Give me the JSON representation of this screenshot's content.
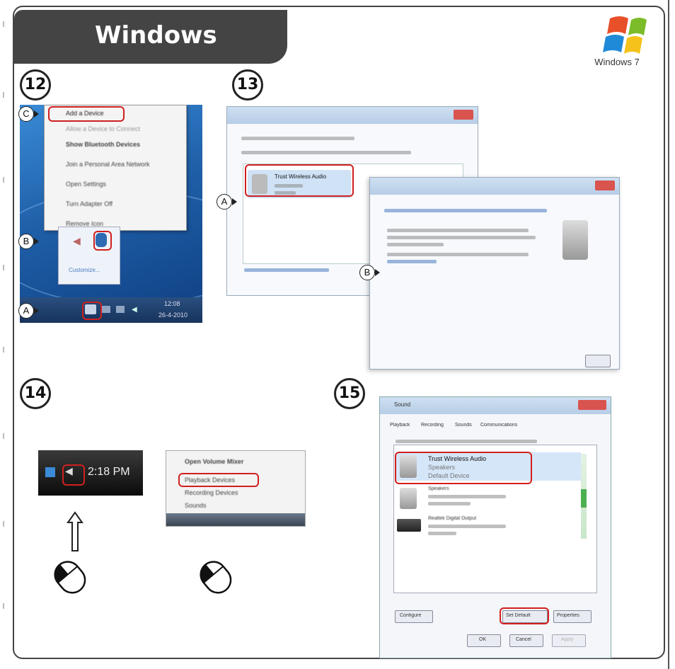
{
  "header": {
    "title": "Windows"
  },
  "logo": {
    "label": "Windows 7",
    "icon": "windows-flag-icon"
  },
  "steps": {
    "s12": "12",
    "s13": "13",
    "s14": "14",
    "s15": "15"
  },
  "callouts": {
    "a": "A",
    "b": "B",
    "c": "C"
  },
  "step12": {
    "menu": [
      "Add a Device",
      "Allow a Device to Connect",
      "Show Bluetooth Devices",
      "Join a Personal Area Network",
      "Open Settings",
      "Turn Adapter Off",
      "Remove Icon"
    ],
    "customize": "Customize...",
    "clock_time": "12:08",
    "clock_date": "26-4-2010"
  },
  "step13": {
    "device_name": "Trust Wireless Audio"
  },
  "step14": {
    "clock": "2:18 PM",
    "menu": [
      "Open Volume Mixer",
      "Playback Devices",
      "Recording Devices",
      "Sounds"
    ]
  },
  "step15": {
    "window_title": "Sound",
    "tabs": [
      "Playback",
      "Recording",
      "Sounds",
      "Communications"
    ],
    "device": {
      "name": "Trust Wireless Audio",
      "type": "Speakers",
      "status": "Default Device"
    },
    "devices_other": [
      "Speakers",
      "Realtek Digital Output"
    ],
    "buttons": {
      "configure": "Configure",
      "set_default": "Set Default",
      "properties": "Properties",
      "ok": "OK",
      "cancel": "Cancel",
      "apply": "Apply"
    }
  },
  "colors": {
    "highlight": "#d0201e",
    "header_bg": "#444444"
  }
}
